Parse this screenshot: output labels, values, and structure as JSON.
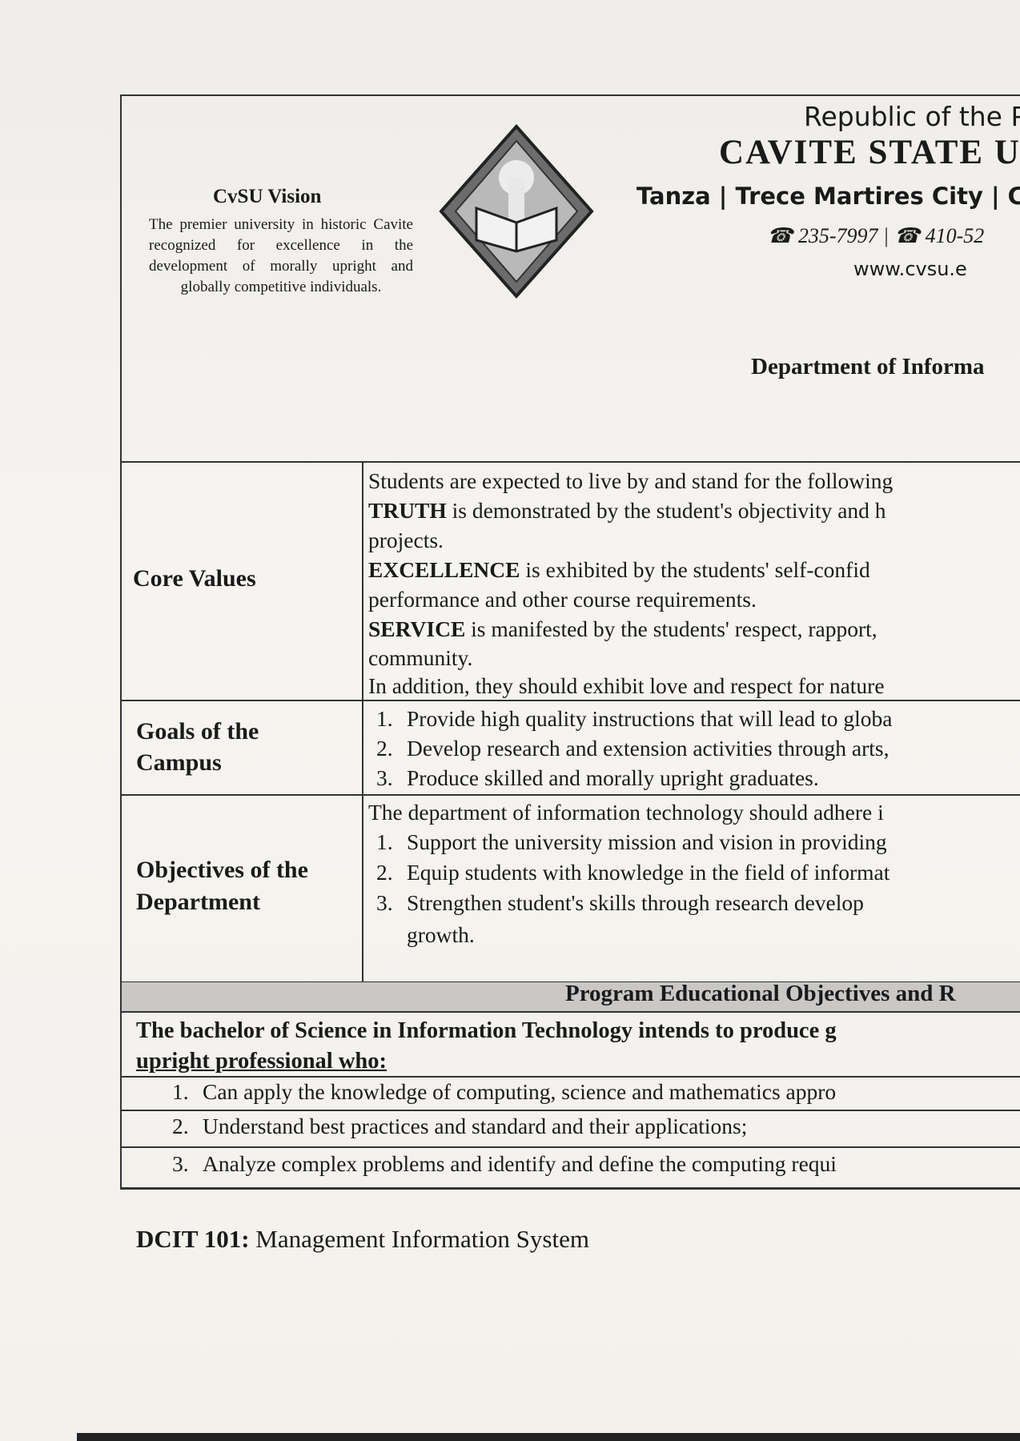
{
  "header": {
    "vision_title": "CvSU Vision",
    "vision_text": "The premier university in historic Cavite recognized for excellence in the development of morally upright and globally competitive individuals.",
    "republic": "Republic of the P",
    "university": "CAVITE STATE U",
    "campuses": "Tanza | Trece Martires City | C",
    "phones": "☎ 235-7997 | ☎ 410-52",
    "website": "www.cvsu.e",
    "department": "Department of Informa"
  },
  "core_values": {
    "label": "Core Values",
    "intro": "Students are expected to live by and stand for the following",
    "truth_key": "TRUTH",
    "truth_text": " is demonstrated by the student's objectivity and h",
    "truth_cont": "projects.",
    "excellence_key": "EXCELLENCE",
    "excellence_text": " is exhibited by the students' self-confid",
    "excellence_cont": "performance and other course requirements.",
    "service_key": "SERVICE",
    "service_text": " is manifested by the students' respect, rapport,",
    "service_cont": "community.",
    "addition": "In addition, they should exhibit love and respect for nature"
  },
  "goals": {
    "label_1": "Goals of the",
    "label_2": "Campus",
    "items": [
      {
        "num": "1.",
        "text": "Provide high quality instructions that will lead to globa"
      },
      {
        "num": "2.",
        "text": "Develop research and extension activities through arts,"
      },
      {
        "num": "3.",
        "text": "Produce skilled and morally upright graduates."
      }
    ]
  },
  "objectives": {
    "label_1": "Objectives of the",
    "label_2": "Department",
    "intro": "The department of information technology should adhere i",
    "items": [
      {
        "num": "1.",
        "text": "Support the university mission and vision in providing"
      },
      {
        "num": "2.",
        "text": "Equip students with knowledge in the field of informat"
      },
      {
        "num": "3.",
        "text": "Strengthen student's skills through research develop"
      }
    ],
    "item3_cont": "growth."
  },
  "peo": {
    "title": "Program Educational Objectives and R",
    "intro_1": "The bachelor of Science in Information Technology intends to produce g",
    "intro_2": "upright professional who:",
    "items": [
      {
        "num": "1.",
        "text": "Can apply the knowledge of computing, science and mathematics appro"
      },
      {
        "num": "2.",
        "text": "Understand best practices and standard and their applications;"
      },
      {
        "num": "3.",
        "text": "Analyze complex problems and identify and define the computing requi"
      }
    ]
  },
  "course": {
    "code": "DCIT 101:",
    "title": " Management Information System"
  }
}
